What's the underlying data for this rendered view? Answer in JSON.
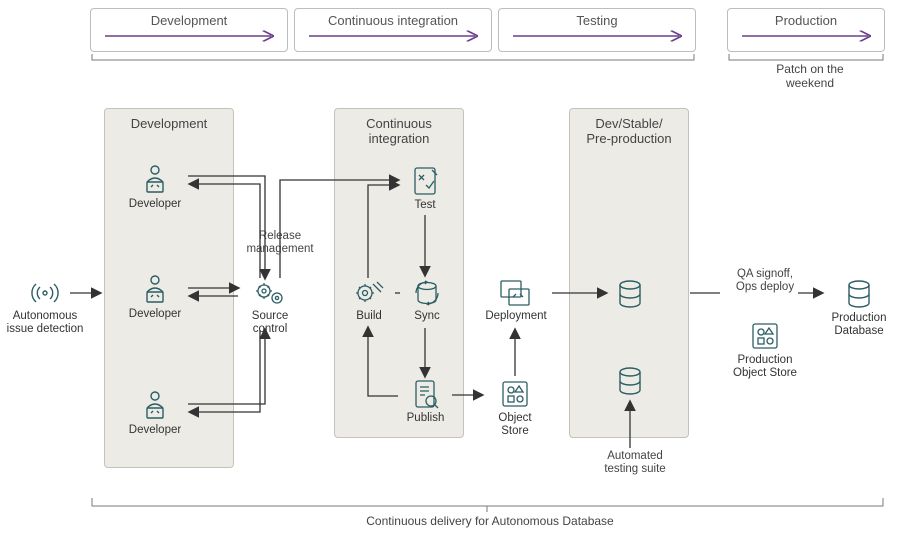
{
  "phases": {
    "development": "Development",
    "ci": "Continuous integration",
    "testing": "Testing",
    "production": "Production"
  },
  "stages": {
    "development": "Development",
    "ci": "Continuous\nintegration",
    "preprod": "Dev/Stable/\nPre-production"
  },
  "nodes": {
    "issue_detect": "Autonomous\nissue detection",
    "developer1": "Developer",
    "developer2": "Developer",
    "developer3": "Developer",
    "source_control": "Source\ncontrol",
    "build": "Build",
    "test": "Test",
    "sync": "Sync",
    "publish": "Publish",
    "deployment": "Deployment",
    "object_store": "Object\nStore",
    "prod_object_store": "Production\nObject Store",
    "prod_db": "Production\nDatabase"
  },
  "labels": {
    "release_mgmt": "Release\nmanagement",
    "qa_signoff": "QA signoff,\nOps deploy",
    "automated_testing": "Automated\ntesting suite",
    "patch_weekend": "Patch on the\nweekend",
    "bottom_caption": "Continuous delivery for Autonomous Database"
  },
  "colors": {
    "phase_arrow": "#6b3f8c",
    "flow_arrow": "#333333",
    "icon_stroke": "#2b5d64"
  }
}
